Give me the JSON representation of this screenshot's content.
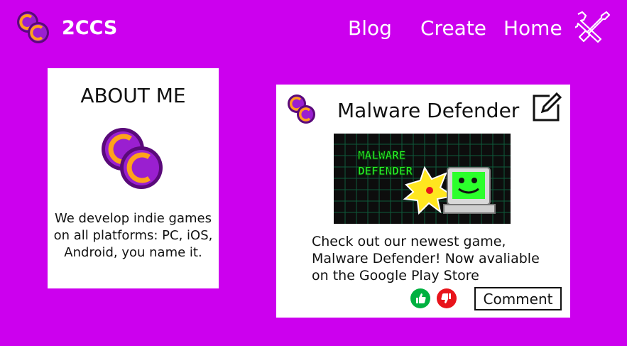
{
  "header": {
    "brand": "2CCS",
    "logo_icon": "pixel-coins-logo-icon",
    "nav": [
      {
        "label": "Blog"
      },
      {
        "label": "Create"
      },
      {
        "label": "Home"
      }
    ],
    "tools_icon": "wrench-screwdriver-icon"
  },
  "about": {
    "title": "ABOUT ME",
    "logo_icon": "pixel-coins-logo-icon",
    "text": "We develop indie games on all platforms: PC, iOS, Android, you name it."
  },
  "post": {
    "title": "Malware Defender",
    "edit_icon": "edit-icon",
    "image_logo_line1": "MALWARE",
    "image_logo_line2": "DEFENDER",
    "body": "Check out our newest game, Malware Defender! Now avaliable on the Google Play Store",
    "like_icon": "thumbs-up-icon",
    "dislike_icon": "thumbs-down-icon",
    "comment_label": "Comment"
  },
  "colors": {
    "background": "#cc00ee",
    "card": "#ffffff",
    "like": "#00b140",
    "dislike": "#e8141b",
    "coin_purple": "#9a1fd0",
    "coin_gold": "#ffa21a",
    "game_bg": "#0d0d0d",
    "game_grid": "#0f5a3a",
    "game_logo": "#2cff2c"
  }
}
